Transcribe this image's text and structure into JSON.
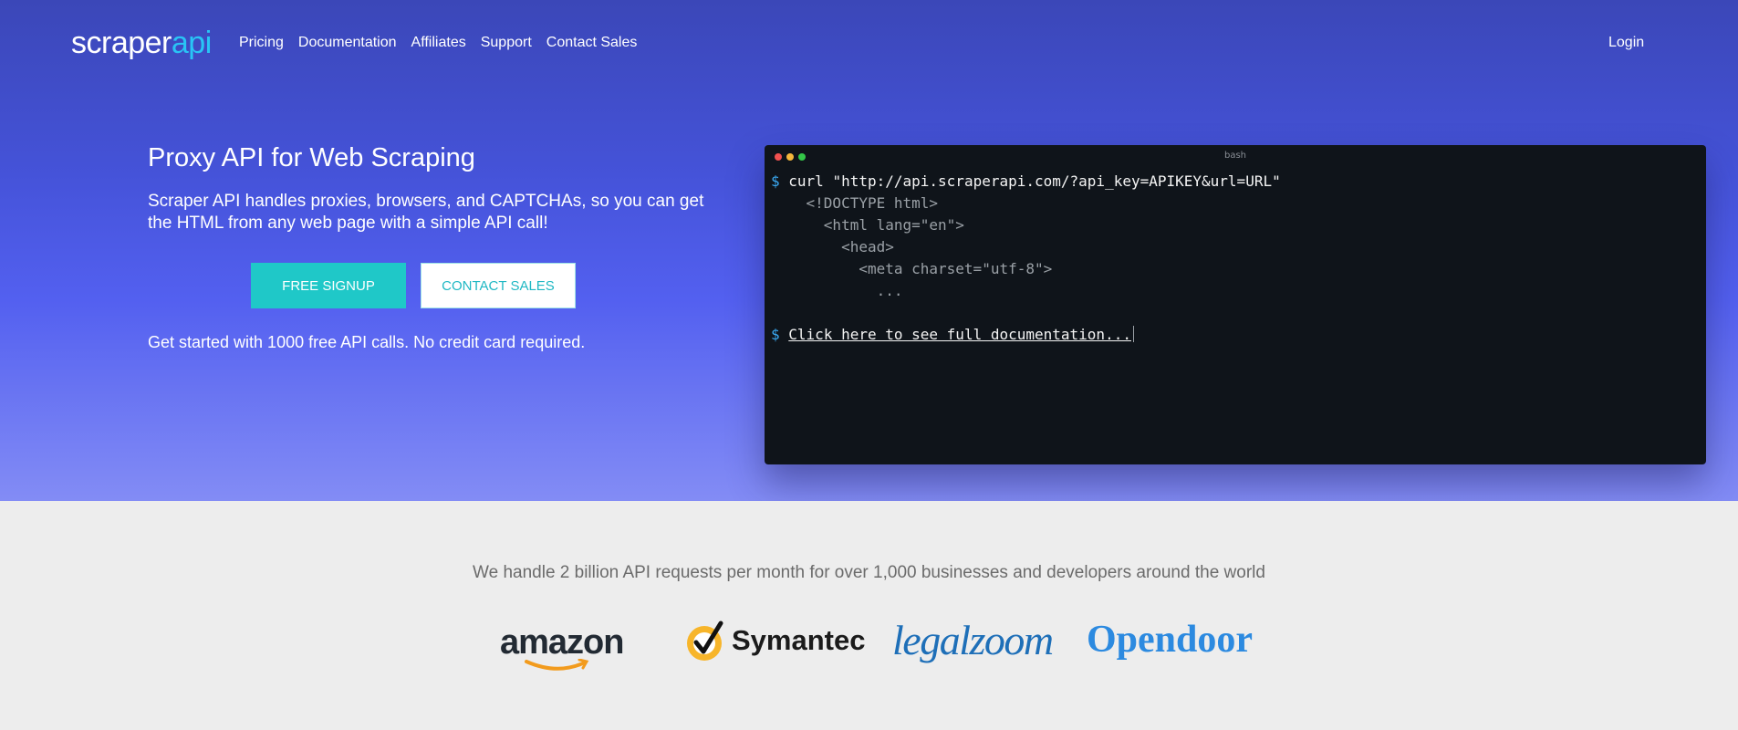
{
  "nav": {
    "logo_main": "scraper",
    "logo_accent": "api",
    "links": [
      "Pricing",
      "Documentation",
      "Affiliates",
      "Support",
      "Contact Sales"
    ],
    "login": "Login"
  },
  "hero": {
    "title": "Proxy API for Web Scraping",
    "subtitle": "Scraper API handles proxies, browsers, and CAPTCHAs, so you can get the HTML from any web page with a simple API call!",
    "primary_button": "FREE SIGNUP",
    "secondary_button": "CONTACT SALES",
    "note": "Get started with 1000 free API calls. No credit card required."
  },
  "terminal": {
    "title": "bash",
    "prompt": "$",
    "command": "curl \"http://api.scraperapi.com/?api_key=APIKEY&url=URL\"",
    "output_lines": [
      "<!DOCTYPE html>",
      "<html lang=\"en\">",
      "<head>",
      "<meta charset=\"utf-8\">",
      "..."
    ],
    "doc_link": "Click here to see full documentation..."
  },
  "social_proof": {
    "stats": "We handle 2 billion API requests per month for over 1,000 businesses and developers around the world",
    "logos": [
      "amazon",
      "Symantec",
      "legalzoom",
      "Opendoor"
    ]
  },
  "colors": {
    "hero_top": "#3b47b8",
    "hero_bottom": "#838cf5",
    "accent_teal": "#1fc8c8",
    "logo_accent": "#29c4f5",
    "terminal_bg": "#0f141a",
    "prompt_blue": "#3aa9f2"
  }
}
